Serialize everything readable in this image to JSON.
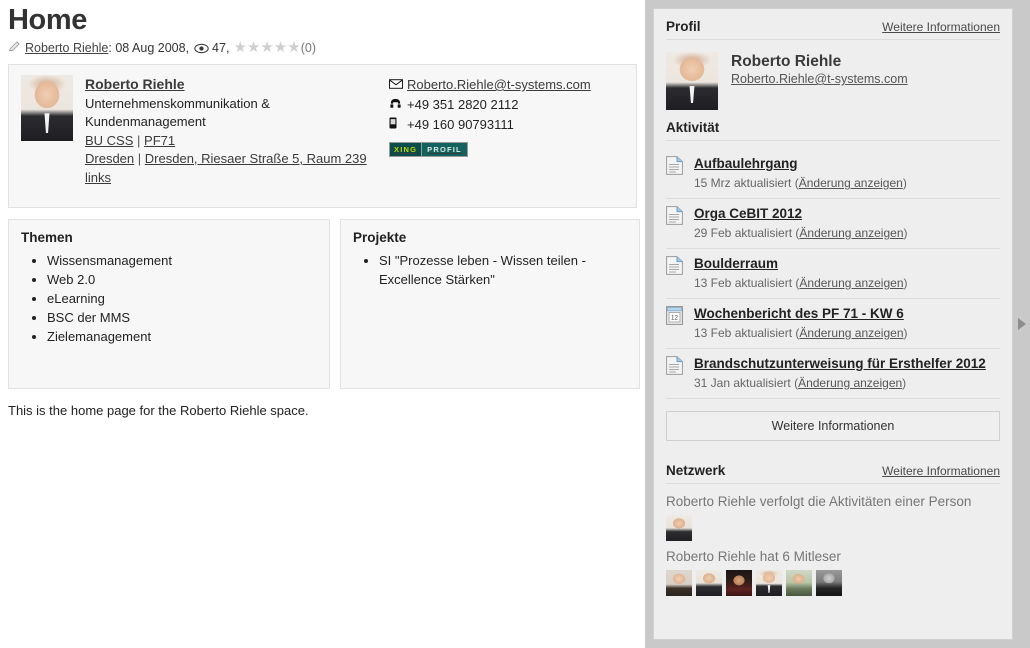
{
  "page": {
    "title": "Home",
    "byline": {
      "author": "Roberto Riehle",
      "after_author": ":",
      "date": "08 Aug 2008,",
      "views": "47,",
      "rating_count": "(0)",
      "stars": 5,
      "stars_filled": 0,
      "pencil_icon": "pencil-icon",
      "eye_icon": "eye-icon"
    },
    "body_text": "This is the home page for the Roberto Riehle space."
  },
  "profile_card": {
    "name": "Roberto Riehle",
    "role_line1": "Unternehmenskommunikation &",
    "role_line2": "Kundenmanagement",
    "org_unit": "BU CSS",
    "org_sep": "|",
    "department": "PF71",
    "city": "Dresden",
    "loc_sep": "|",
    "address": "Dresden, Riesaer Straße 5, Raum 239 links",
    "email": "Roberto.Riehle@t-systems.com",
    "phone": "+49 351 2820 2112",
    "mobile": "+49 160 90793111",
    "email_icon": "envelope-icon",
    "phone_icon": "telephone-icon",
    "mobile_icon": "mobile-phone-icon",
    "xing_left": "XING",
    "xing_right": "PROFIL"
  },
  "panels": {
    "themen": {
      "title": "Themen",
      "items": [
        "Wissensmanagement",
        "Web 2.0",
        "eLearning",
        "BSC der MMS",
        "Zielemanagement"
      ]
    },
    "projekte": {
      "title": "Projekte",
      "items": [
        "SI \"Prozesse leben - Wissen teilen - Excellence Stärken\""
      ]
    }
  },
  "sidebar": {
    "profile_section": {
      "title": "Profil",
      "more_link": "Weitere Informationen",
      "name": "Roberto Riehle",
      "email": "Roberto.Riehle@t-systems.com",
      "avatar_icon": "profile-photo"
    },
    "activity_section": {
      "title": "Aktivität",
      "items": [
        {
          "icon": "document-page-icon",
          "title": "Aufbaulehrgang",
          "date": "15 Mrz aktualisiert",
          "change_prefix": "(",
          "change_link": "Änderung anzeigen",
          "change_suffix": ")"
        },
        {
          "icon": "document-page-icon",
          "title": "Orga CeBIT 2012",
          "date": "29 Feb aktualisiert",
          "change_prefix": "(",
          "change_link": "Änderung anzeigen",
          "change_suffix": ")"
        },
        {
          "icon": "document-page-icon",
          "title": "Boulderraum",
          "date": "13 Feb aktualisiert",
          "change_prefix": "(",
          "change_link": "Änderung anzeigen",
          "change_suffix": ")"
        },
        {
          "icon": "calendar-document-icon",
          "title": "Wochenbericht des PF 71 - KW 6",
          "date": "13 Feb aktualisiert",
          "change_prefix": "(",
          "change_link": "Änderung anzeigen",
          "change_suffix": ")"
        },
        {
          "icon": "document-page-icon",
          "title": "Brandschutzunterweisung für Ersthelfer 2012",
          "date": "31 Jan aktualisiert",
          "change_prefix": "(",
          "change_link": "Änderung anzeigen",
          "change_suffix": ")"
        }
      ],
      "more_button": "Weitere Informationen"
    },
    "network_section": {
      "title": "Netzwerk",
      "more_link": "Weitere Informationen",
      "following_text": "Roberto Riehle verfolgt die Aktivitäten einer Person",
      "following_avatars": [
        "avatar-roberto"
      ],
      "followers_text": "Roberto Riehle hat 6 Mitleser",
      "follower_avatars": [
        "avatar-follower-1",
        "avatar-follower-2",
        "avatar-follower-3",
        "avatar-follower-4",
        "avatar-follower-5",
        "avatar-follower-6"
      ]
    },
    "collapse_arrow_icon": "collapse-right-arrow-icon"
  },
  "colors": {
    "panel_bg": "#eeeeee",
    "card_bg": "#f7f7f7",
    "border": "#e2e2e2",
    "outer_strip": "#c9c9c9",
    "link": "#3b3b3b",
    "muted": "#767676",
    "xing_dark": "#0a4d4a",
    "xing_accent": "#c8d400"
  }
}
